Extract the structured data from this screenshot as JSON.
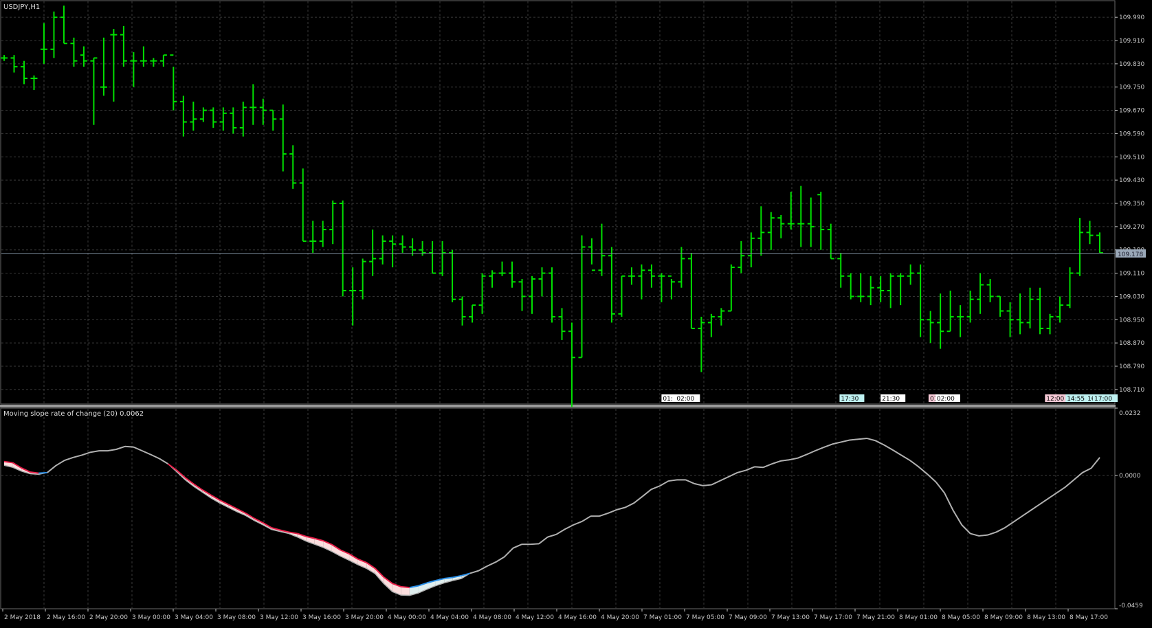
{
  "window": {
    "symbol_label": "USDJPY,H1"
  },
  "colors": {
    "background": "#000000",
    "grid": "#3a3a3a",
    "bars": "#00e000",
    "axis_text": "#c8c8c8",
    "price_line": "#7a8a9a",
    "price_badge": "#9aa8b8",
    "divider": "#9a9a9a",
    "indicator_line": "#b0b0b0",
    "up_color": "#2a8fe8",
    "up_fill": "#dfeeee",
    "down_color": "#e8204a",
    "down_fill": "#fbdede"
  },
  "price_panel": {
    "y_ticks": [
      "109.990",
      "109.910",
      "109.830",
      "109.750",
      "109.670",
      "109.590",
      "109.510",
      "109.430",
      "109.350",
      "109.270",
      "109.190",
      "109.110",
      "109.030",
      "108.950",
      "108.870",
      "108.790",
      "108.710"
    ],
    "current_price_label": "109.178"
  },
  "event_markers": [
    {
      "label": "01:",
      "style": "white"
    },
    {
      "label": "02:00",
      "style": "white"
    },
    {
      "label": "17:30",
      "style": "cyan"
    },
    {
      "label": "21:30",
      "style": "white"
    },
    {
      "label": "01:",
      "style": "pink"
    },
    {
      "label": "02:00",
      "style": "white"
    },
    {
      "label": "12:00",
      "style": "pink"
    },
    {
      "label": "14:55",
      "style": "cyan"
    },
    {
      "label": "16:",
      "style": "cyan"
    },
    {
      "label": "17:00",
      "style": "cyan"
    }
  ],
  "indicator": {
    "title": "Moving slope rate of change (20) 0.0062",
    "y_ticks": [
      "0.0232",
      "0.0000",
      "-0.0459"
    ]
  },
  "x_ticks": [
    "2 May 2018",
    "2 May 16:00",
    "2 May 20:00",
    "3 May 00:00",
    "3 May 04:00",
    "3 May 08:00",
    "3 May 12:00",
    "3 May 16:00",
    "3 May 20:00",
    "4 May 00:00",
    "4 May 04:00",
    "4 May 08:00",
    "4 May 12:00",
    "4 May 16:00",
    "4 May 20:00",
    "7 May 01:00",
    "7 May 05:00",
    "7 May 09:00",
    "7 May 13:00",
    "7 May 17:00",
    "7 May 21:00",
    "8 May 01:00",
    "8 May 05:00",
    "8 May 09:00",
    "8 May 13:00",
    "8 May 17:00"
  ],
  "chart_data": [
    {
      "type": "ohlc",
      "title": "USDJPY,H1",
      "timeframe": "H1",
      "x_start": "2 May 2018",
      "x_end": "8 May 17:00",
      "ylim": [
        108.66,
        110.04
      ],
      "grid": true,
      "bars": [
        [
          109.85,
          109.86,
          109.84,
          109.85
        ],
        [
          109.85,
          109.86,
          109.8,
          109.82
        ],
        [
          109.82,
          109.84,
          109.76,
          109.78
        ],
        [
          109.78,
          109.79,
          109.74,
          109.78
        ],
        [
          109.88,
          109.97,
          109.83,
          109.88
        ],
        [
          109.88,
          110.01,
          109.85,
          109.99
        ],
        [
          109.99,
          110.03,
          109.9,
          109.9
        ],
        [
          109.9,
          109.92,
          109.82,
          109.84
        ],
        [
          109.86,
          109.89,
          109.82,
          109.84
        ],
        [
          109.84,
          109.85,
          109.62,
          109.85
        ],
        [
          109.75,
          109.92,
          109.72,
          109.75
        ],
        [
          109.93,
          109.95,
          109.7,
          109.93
        ],
        [
          109.93,
          109.96,
          109.82,
          109.84
        ],
        [
          109.84,
          109.87,
          109.75,
          109.84
        ],
        [
          109.84,
          109.89,
          109.82,
          109.84
        ],
        [
          109.84,
          109.85,
          109.82,
          109.84
        ],
        [
          109.84,
          109.86,
          109.82,
          109.86
        ],
        [
          109.86,
          109.82,
          109.67,
          109.7
        ],
        [
          109.7,
          109.72,
          109.58,
          109.63
        ],
        [
          109.63,
          109.7,
          109.6,
          109.64
        ],
        [
          109.64,
          109.68,
          109.63,
          109.67
        ],
        [
          109.67,
          109.68,
          109.61,
          109.63
        ],
        [
          109.63,
          109.68,
          109.6,
          109.66
        ],
        [
          109.66,
          109.68,
          109.59,
          109.61
        ],
        [
          109.61,
          109.7,
          109.58,
          109.68
        ],
        [
          109.68,
          109.76,
          109.62,
          109.68
        ],
        [
          109.68,
          109.71,
          109.62,
          109.67
        ],
        [
          109.67,
          109.67,
          109.6,
          109.64
        ],
        [
          109.64,
          109.69,
          109.46,
          109.52
        ],
        [
          109.52,
          109.55,
          109.4,
          109.42
        ],
        [
          109.42,
          109.47,
          109.22,
          109.22
        ],
        [
          109.22,
          109.29,
          109.18,
          109.22
        ],
        [
          109.22,
          109.29,
          109.2,
          109.26
        ],
        [
          109.26,
          109.36,
          109.21,
          109.35
        ],
        [
          109.35,
          109.36,
          109.03,
          109.05
        ],
        [
          109.05,
          109.13,
          108.93,
          109.05
        ],
        [
          109.05,
          109.16,
          109.02,
          109.15
        ],
        [
          109.15,
          109.26,
          109.1,
          109.16
        ],
        [
          109.16,
          109.24,
          109.14,
          109.22
        ],
        [
          109.22,
          109.24,
          109.13,
          109.21
        ],
        [
          109.21,
          109.24,
          109.18,
          109.2
        ],
        [
          109.2,
          109.23,
          109.17,
          109.19
        ],
        [
          109.19,
          109.22,
          109.17,
          109.18
        ],
        [
          109.18,
          109.22,
          109.11,
          109.11
        ],
        [
          109.11,
          109.22,
          109.1,
          109.18
        ],
        [
          109.18,
          109.19,
          109.01,
          109.02
        ],
        [
          109.02,
          109.03,
          108.93,
          108.96
        ],
        [
          108.96,
          109.0,
          108.94,
          109.0
        ],
        [
          109.0,
          109.11,
          108.97,
          109.1
        ],
        [
          109.1,
          109.12,
          109.06,
          109.11
        ],
        [
          109.11,
          109.15,
          109.1,
          109.11
        ],
        [
          109.11,
          109.15,
          109.06,
          109.08
        ],
        [
          109.08,
          109.09,
          108.98,
          109.03
        ],
        [
          109.03,
          109.1,
          108.97,
          109.09
        ],
        [
          109.09,
          109.13,
          109.03,
          109.11
        ],
        [
          109.11,
          109.13,
          108.94,
          108.96
        ],
        [
          108.96,
          108.99,
          108.88,
          108.91
        ],
        [
          108.91,
          108.94,
          108.65,
          108.82
        ],
        [
          108.82,
          109.24,
          108.82,
          109.2
        ],
        [
          109.2,
          109.23,
          109.14,
          109.12
        ],
        [
          109.12,
          109.28,
          109.1,
          109.17
        ],
        [
          109.17,
          109.2,
          108.94,
          108.97
        ],
        [
          108.97,
          109.1,
          108.96,
          109.1
        ],
        [
          109.1,
          109.13,
          109.07,
          109.1
        ],
        [
          109.1,
          109.14,
          109.02,
          109.12
        ],
        [
          109.12,
          109.14,
          109.06,
          109.1
        ],
        [
          109.1,
          109.11,
          109.01,
          109.1
        ],
        [
          109.1,
          109.09,
          109.02,
          109.08
        ],
        [
          109.08,
          109.2,
          109.06,
          109.16
        ],
        [
          109.16,
          109.18,
          108.92,
          108.92
        ],
        [
          108.92,
          108.96,
          108.77,
          108.94
        ],
        [
          108.94,
          108.97,
          108.89,
          108.96
        ],
        [
          108.96,
          108.99,
          108.93,
          108.98
        ],
        [
          108.98,
          109.14,
          108.98,
          109.13
        ],
        [
          109.13,
          109.22,
          109.11,
          109.17
        ],
        [
          109.17,
          109.25,
          109.13,
          109.23
        ],
        [
          109.23,
          109.34,
          109.17,
          109.25
        ],
        [
          109.25,
          109.32,
          109.19,
          109.3
        ],
        [
          109.3,
          109.31,
          109.23,
          109.28
        ],
        [
          109.28,
          109.39,
          109.26,
          109.28
        ],
        [
          109.28,
          109.41,
          109.2,
          109.28
        ],
        [
          109.28,
          109.37,
          109.2,
          109.27
        ],
        [
          109.38,
          109.39,
          109.19,
          109.26
        ],
        [
          109.26,
          109.28,
          109.16,
          109.16
        ],
        [
          109.16,
          109.18,
          109.06,
          109.1
        ],
        [
          109.1,
          109.11,
          109.02,
          109.03
        ],
        [
          109.03,
          109.11,
          109.01,
          109.03
        ],
        [
          109.03,
          109.1,
          109.0,
          109.06
        ],
        [
          109.06,
          109.1,
          109.01,
          109.05
        ],
        [
          109.05,
          109.11,
          108.99,
          109.1
        ],
        [
          109.1,
          109.11,
          109.0,
          109.1
        ],
        [
          109.1,
          109.14,
          109.07,
          109.11
        ],
        [
          109.11,
          109.14,
          108.89,
          108.95
        ],
        [
          108.95,
          108.98,
          108.87,
          108.94
        ],
        [
          108.94,
          109.04,
          108.85,
          108.91
        ],
        [
          108.91,
          109.05,
          108.91,
          108.96
        ],
        [
          108.96,
          109.0,
          108.89,
          108.96
        ],
        [
          108.96,
          109.05,
          108.94,
          109.02
        ],
        [
          109.02,
          109.11,
          108.97,
          109.07
        ],
        [
          109.07,
          109.09,
          109.01,
          109.03
        ],
        [
          109.03,
          109.03,
          108.96,
          108.98
        ],
        [
          108.98,
          109.01,
          108.89,
          108.95
        ],
        [
          108.95,
          109.04,
          108.9,
          108.94
        ],
        [
          108.94,
          109.06,
          108.92,
          109.02
        ],
        [
          109.02,
          109.06,
          108.9,
          108.92
        ],
        [
          108.92,
          108.97,
          108.9,
          108.96
        ],
        [
          108.96,
          109.03,
          108.94,
          109.0
        ],
        [
          109.0,
          109.13,
          108.99,
          109.11
        ],
        [
          109.11,
          109.3,
          109.1,
          109.25
        ],
        [
          109.25,
          109.29,
          109.21,
          109.24
        ],
        [
          109.24,
          109.25,
          109.18,
          109.18
        ]
      ]
    },
    {
      "type": "line",
      "title": "Moving slope rate of change (20) 0.0062",
      "ylim": [
        -0.0459,
        0.0232
      ],
      "grid": true,
      "x_start": "2 May 2018",
      "x_end": "8 May 17:00",
      "values": [
        0.0048,
        0.0044,
        0.0026,
        0.0012,
        0.0008,
        0.001,
        0.0034,
        0.0052,
        0.0062,
        0.007,
        0.008,
        0.0085,
        0.0085,
        0.009,
        0.01,
        0.0098,
        0.0085,
        0.0072,
        0.0058,
        0.004,
        0.0018,
        -0.0008,
        -0.003,
        -0.005,
        -0.0068,
        -0.0085,
        -0.01,
        -0.0115,
        -0.013,
        -0.0148,
        -0.0163,
        -0.018,
        -0.0188,
        -0.0195,
        -0.02,
        -0.021,
        -0.0217,
        -0.0225,
        -0.0238,
        -0.0257,
        -0.027,
        -0.0288,
        -0.03,
        -0.032,
        -0.035,
        -0.0372,
        -0.0383,
        -0.0386,
        -0.038,
        -0.037,
        -0.0362,
        -0.0355,
        -0.0351,
        -0.0345,
        -0.0337,
        -0.0328,
        -0.0312,
        -0.0298,
        -0.028,
        -0.025,
        -0.0237,
        -0.0237,
        -0.0235,
        -0.0212,
        -0.0203,
        -0.0185,
        -0.017,
        -0.0158,
        -0.014,
        -0.014,
        -0.013,
        -0.0118,
        -0.011,
        -0.0095,
        -0.0072,
        -0.0048,
        -0.0036,
        -0.0019,
        -0.0015,
        -0.0015,
        -0.0028,
        -0.0035,
        -0.0032,
        -0.0018,
        -0.0004,
        0.001,
        0.0018,
        0.003,
        0.0028,
        0.004,
        0.005,
        0.0054,
        0.006,
        0.0072,
        0.0085,
        0.0097,
        0.0108,
        0.0115,
        0.0122,
        0.0125,
        0.0128,
        0.012,
        0.0105,
        0.0088,
        0.007,
        0.0052,
        0.003,
        0.0005,
        -0.0022,
        -0.006,
        -0.012,
        -0.017,
        -0.02,
        -0.0208,
        -0.0205,
        -0.0195,
        -0.018,
        -0.016,
        -0.014,
        -0.012,
        -0.01,
        -0.008,
        -0.006,
        -0.004,
        -0.0015,
        0.001,
        0.0025,
        0.0062
      ],
      "signal": [
        0.0035,
        0.0028,
        0.0015,
        0.0006,
        0.0004,
        0.001,
        0.0034,
        0.0052,
        0.0062,
        0.007,
        0.008,
        0.0085,
        0.0085,
        0.009,
        0.01,
        0.0098,
        0.0085,
        0.0072,
        0.0058,
        0.004,
        0.0013,
        -0.0015,
        -0.0038,
        -0.0058,
        -0.0078,
        -0.0095,
        -0.011,
        -0.0125,
        -0.0138,
        -0.0155,
        -0.017,
        -0.0186,
        -0.0193,
        -0.02,
        -0.0212,
        -0.0226,
        -0.0237,
        -0.0248,
        -0.0262,
        -0.0278,
        -0.0292,
        -0.0307,
        -0.032,
        -0.0338,
        -0.0372,
        -0.04,
        -0.0412,
        -0.0413,
        -0.0405,
        -0.0392,
        -0.038,
        -0.037,
        -0.0362,
        -0.0355,
        -0.0337,
        -0.0328,
        -0.0312,
        -0.0298,
        -0.028,
        -0.025,
        -0.0237,
        -0.0237,
        -0.0235,
        -0.0212,
        -0.0203,
        -0.0185,
        -0.017,
        -0.0158,
        -0.014,
        -0.014,
        -0.013,
        -0.0118,
        -0.011,
        -0.0095,
        -0.0072,
        -0.0048,
        -0.0036,
        -0.0019,
        -0.0015,
        -0.0015,
        -0.0028,
        -0.0035,
        -0.0032,
        -0.0018,
        -0.0004,
        0.001,
        0.0018,
        0.003,
        0.0028,
        0.004,
        0.005,
        0.0054,
        0.006,
        0.0072,
        0.0085,
        0.0097,
        0.0108,
        0.0115,
        0.0122,
        0.0125,
        0.0128,
        0.012,
        0.0105,
        0.0088,
        0.007,
        0.0052,
        0.003,
        0.0005,
        -0.0022,
        -0.006,
        -0.012,
        -0.017,
        -0.02,
        -0.0208,
        -0.0205,
        -0.0195,
        -0.018,
        -0.016,
        -0.014,
        -0.012,
        -0.01,
        -0.008,
        -0.006,
        -0.004,
        -0.0015,
        0.001,
        0.0025,
        0.0062
      ]
    }
  ]
}
